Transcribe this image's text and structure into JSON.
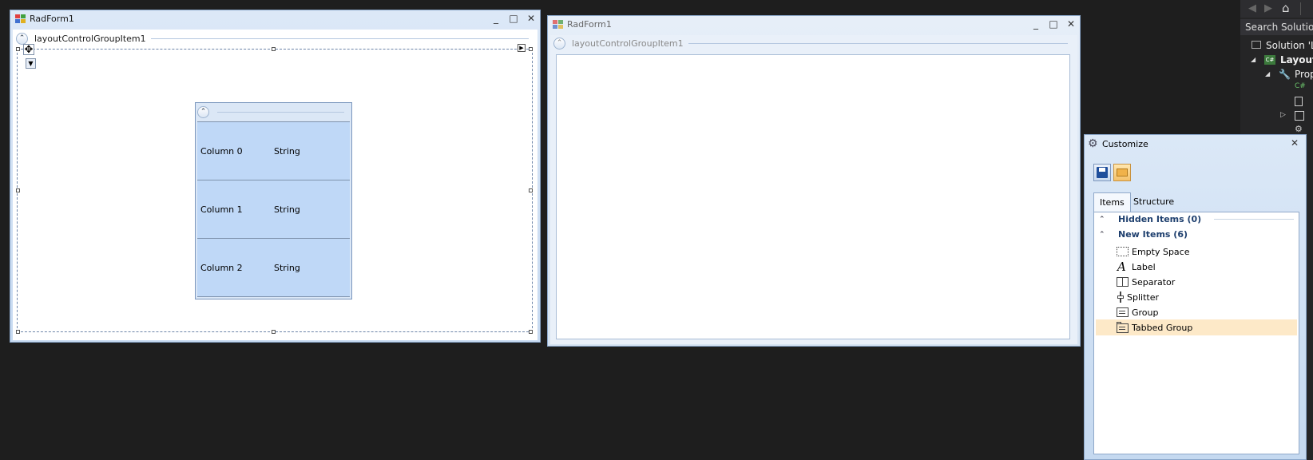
{
  "form1": {
    "title": "RadForm1",
    "group_label": "layoutControlGroupItem1",
    "grid_rows": [
      {
        "name": "Column 0",
        "type": "String"
      },
      {
        "name": "Column 1",
        "type": "String"
      },
      {
        "name": "Column 2",
        "type": "String"
      }
    ]
  },
  "form2": {
    "title": "RadForm1",
    "group_label": "layoutControlGroupItem1"
  },
  "window_controls": {
    "minimize": "_",
    "maximize": "□",
    "close": "✕"
  },
  "solution_explorer": {
    "search_placeholder": "Search Solution",
    "solution": "Solution 'L",
    "project": "Layout",
    "properties": "Prop"
  },
  "customize": {
    "title": "Customize",
    "tabs": [
      "Items",
      "Structure"
    ],
    "sections": [
      {
        "label": "Hidden Items (0)"
      },
      {
        "label": "New Items (6)"
      }
    ],
    "items": [
      {
        "label": "Empty Space",
        "icon": "empty-space-icon"
      },
      {
        "label": "Label",
        "icon": "label-icon"
      },
      {
        "label": "Separator",
        "icon": "separator-icon"
      },
      {
        "label": "Splitter",
        "icon": "splitter-icon"
      },
      {
        "label": "Group",
        "icon": "group-icon"
      },
      {
        "label": "Tabbed Group",
        "icon": "tabbed-group-icon"
      }
    ],
    "colors": {
      "selected_item": "#fde9c8",
      "section_header": "#1e3f6e"
    }
  }
}
